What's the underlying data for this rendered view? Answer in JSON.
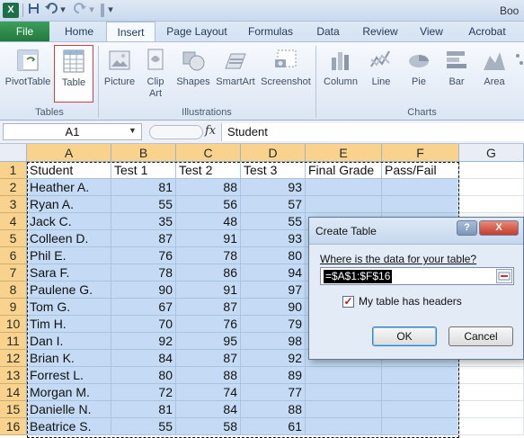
{
  "window": {
    "title": "Boo",
    "app_icon": "excel-icon"
  },
  "ribbon_tabs": [
    "File",
    "Home",
    "Insert",
    "Page Layout",
    "Formulas",
    "Data",
    "Review",
    "View",
    "Acrobat"
  ],
  "active_tab": "Insert",
  "ribbon": {
    "groups": {
      "tables": "Tables",
      "illustrations": "Illustrations",
      "charts": "Charts"
    },
    "buttons": {
      "pivottable": "PivotTable",
      "table": "Table",
      "picture": "Picture",
      "clip_art": "Clip Art",
      "shapes": "Shapes",
      "smartart": "SmartArt",
      "screenshot": "Screenshot",
      "column": "Column",
      "line": "Line",
      "pie": "Pie",
      "bar": "Bar",
      "area": "Area"
    }
  },
  "formula_bar": {
    "name_box": "A1",
    "fx": "fx",
    "value": "Student"
  },
  "columns": [
    "A",
    "B",
    "C",
    "D",
    "E",
    "F",
    "G"
  ],
  "rows": [
    "1",
    "2",
    "3",
    "4",
    "5",
    "6",
    "7",
    "8",
    "9",
    "10",
    "11",
    "12",
    "13",
    "14",
    "15",
    "16"
  ],
  "sheet": {
    "headers": [
      "Student",
      "Test 1",
      "Test 2",
      "Test 3",
      "Final Grade",
      "Pass/Fail"
    ],
    "data": [
      [
        "Heather A.",
        "81",
        "88",
        "93"
      ],
      [
        "Ryan A.",
        "55",
        "56",
        "57"
      ],
      [
        "Jack C.",
        "35",
        "48",
        "55"
      ],
      [
        "Colleen D.",
        "87",
        "91",
        "93"
      ],
      [
        "Phil E.",
        "76",
        "78",
        "80"
      ],
      [
        "Sara F.",
        "78",
        "86",
        "94"
      ],
      [
        "Paulene G.",
        "90",
        "91",
        "97"
      ],
      [
        "Tom G.",
        "67",
        "87",
        "90"
      ],
      [
        "Tim H.",
        "70",
        "76",
        "79"
      ],
      [
        "Dan I.",
        "92",
        "95",
        "98"
      ],
      [
        "Brian K.",
        "84",
        "87",
        "92"
      ],
      [
        "Forrest L.",
        "80",
        "88",
        "89"
      ],
      [
        "Morgan M.",
        "72",
        "74",
        "77"
      ],
      [
        "Danielle N.",
        "81",
        "84",
        "88"
      ],
      [
        "Beatrice S.",
        "55",
        "58",
        "61"
      ]
    ]
  },
  "dialog": {
    "title": "Create Table",
    "help": "?",
    "close": "X",
    "prompt": "Where is the data for your table?",
    "range": "=$A$1:$F$16",
    "checkbox_checked": true,
    "checkbox_label": "My table has headers",
    "ok": "OK",
    "cancel": "Cancel"
  },
  "colors": {
    "selection_fill": "#c5dbf5",
    "header_highlight": "#f9d38d",
    "file_tab": "#217a3d"
  }
}
